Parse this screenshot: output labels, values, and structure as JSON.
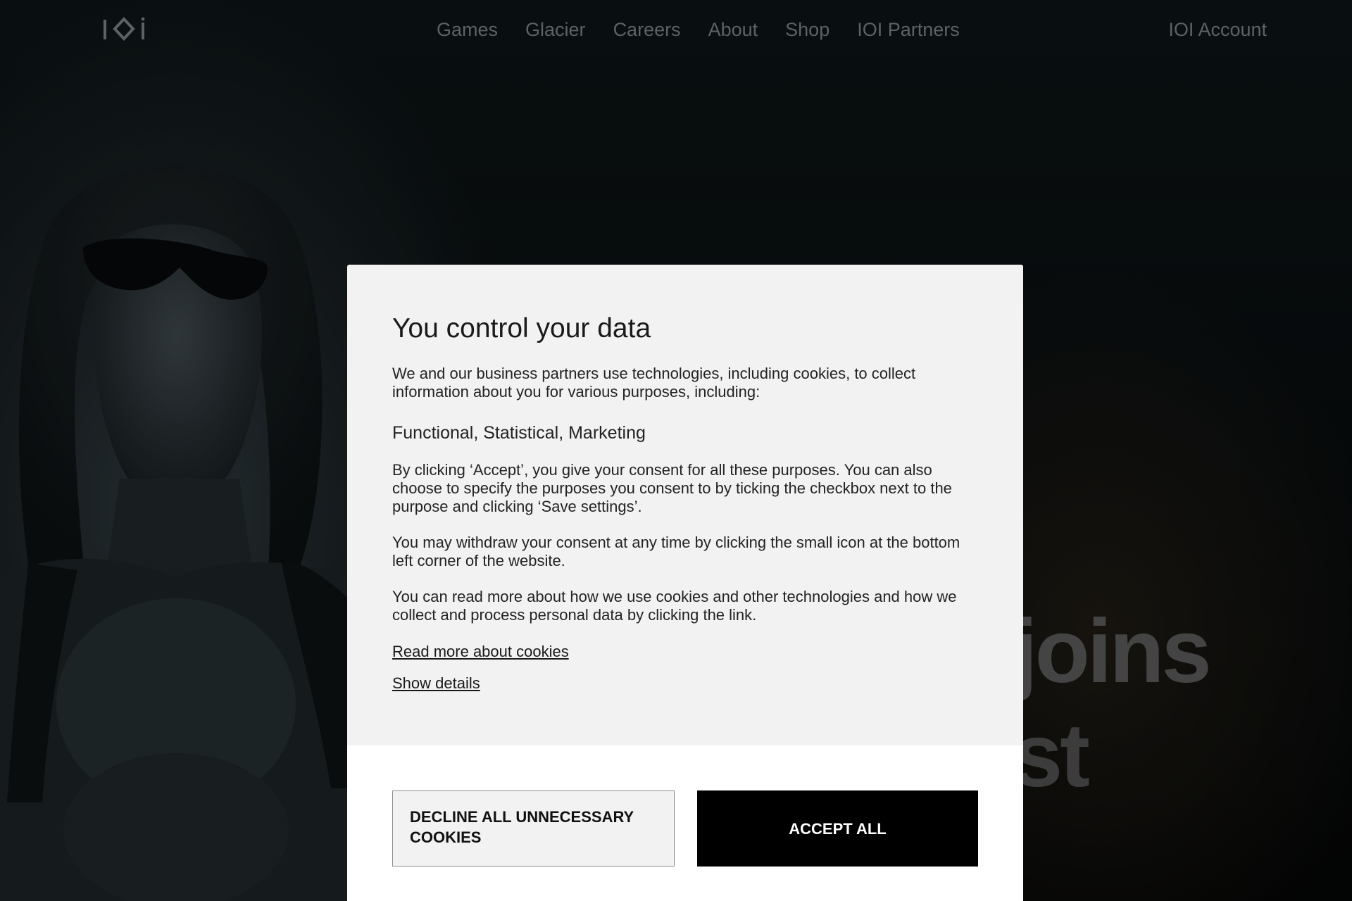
{
  "nav": {
    "logo_alt": "IOI",
    "links": [
      "Games",
      "Glacier",
      "Careers",
      "About",
      "Shop",
      "IOI Partners"
    ],
    "account": "IOI Account"
  },
  "hero": {
    "headline_line1": "joins",
    "headline_line2": "st"
  },
  "cookie_modal": {
    "title": "You control your data",
    "intro": "We and our business partners use technologies, including cookies, to collect information about you for various purposes, including:",
    "purposes": "Functional, Statistical, Marketing",
    "consent_text": "By clicking ‘Accept’, you give your consent for all these purposes. You can also choose to specify the purposes you consent to by ticking the checkbox next to the purpose and clicking ‘Save settings’.",
    "withdraw_text": "You may withdraw your consent at any time by clicking the small icon at the bottom left corner of the website.",
    "read_more_text": "You can read more about how we use cookies and other technologies and how we collect and process personal data by clicking the link.",
    "read_more_link": "Read more about cookies",
    "show_details_link": "Show details",
    "decline_button": "DECLINE ALL UNNECESSARY COOKIES",
    "accept_button": "ACCEPT ALL"
  },
  "colors": {
    "modal_background": "#f1f2f1",
    "footer_background": "#ffffff",
    "accept_button": "#000000",
    "nav_text": "#5b6366"
  }
}
